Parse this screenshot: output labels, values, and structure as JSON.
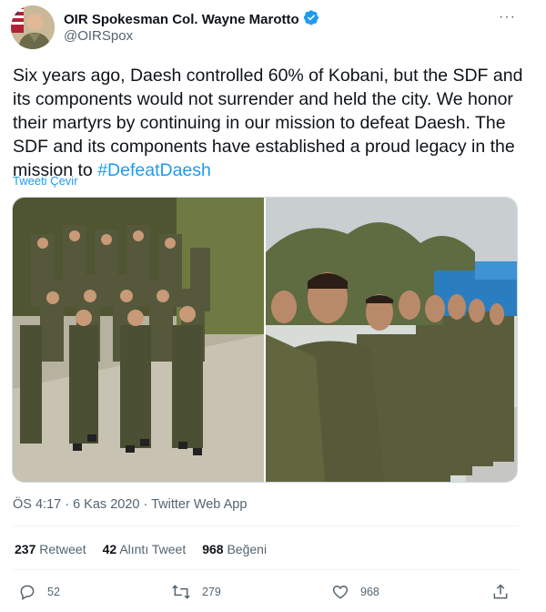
{
  "author": {
    "name": "OIR Spokesman Col. Wayne Marotto",
    "handle": "@OIRSpox",
    "verified_icon": "verified-badge-icon"
  },
  "tweet": {
    "text_main": "Six years ago, Daesh controlled 60% of Kobani, but the SDF and its components would not surrender and held the city. We honor their martyrs by continuing in our mission to defeat Daesh. The SDF and its components have established a proud legacy in the mission to ",
    "hashtag": "#DefeatDaesh",
    "translate_label": "Tweeti Çevir",
    "timestamp": "ÖS 4:17 · 6 Kas 2020 · Twitter Web App"
  },
  "stats": {
    "retweets_count": "237",
    "retweets_label": "Retweet",
    "quotes_count": "42",
    "quotes_label": "Alıntı Tweet",
    "likes_count": "968",
    "likes_label": "Beğeni"
  },
  "actions": {
    "reply_count": "52",
    "retweet_count": "279",
    "like_count": "968"
  },
  "colors": {
    "accent": "#1d9bf0",
    "text": "#0f1419",
    "muted": "#536471"
  }
}
